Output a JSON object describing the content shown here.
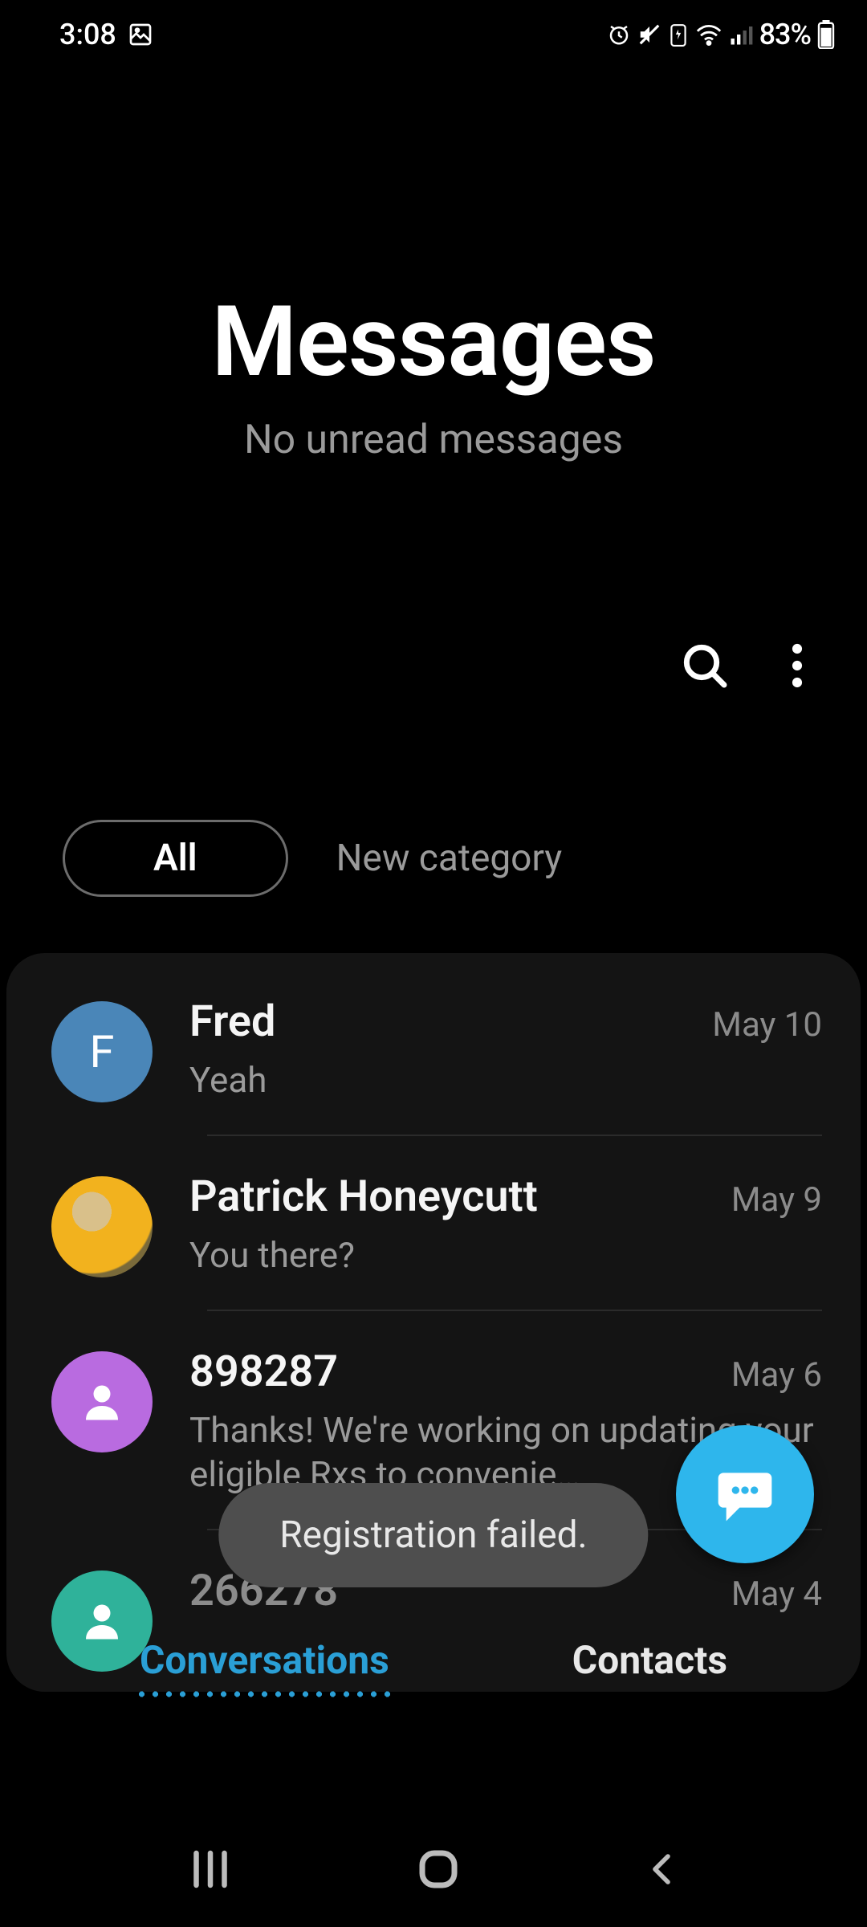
{
  "status": {
    "time": "3:08",
    "battery_text": "83%"
  },
  "header": {
    "title": "Messages",
    "subtitle": "No unread messages"
  },
  "chips": {
    "all": "All",
    "new_category": "New category"
  },
  "conversations": [
    {
      "name": "Fred",
      "preview": "Yeah",
      "date": "May 10",
      "avatar_type": "letter",
      "avatar_letter": "F",
      "avatar_color": "#4a86b8"
    },
    {
      "name": "Patrick Honeycutt",
      "preview": "You there?",
      "date": "May 9",
      "avatar_type": "photo",
      "avatar_letter": "",
      "avatar_color": "#f2b21e"
    },
    {
      "name": "898287",
      "preview": "Thanks! We're working on updating your eligible Rxs to convenie…",
      "date": "May 6",
      "avatar_type": "icon",
      "avatar_letter": "",
      "avatar_color": "#b96be0"
    },
    {
      "name": "266278",
      "preview": "",
      "date": "May 4",
      "avatar_type": "icon",
      "avatar_letter": "",
      "avatar_color": "#2fb29a"
    }
  ],
  "toast": {
    "text": "Registration failed."
  },
  "tabs": {
    "conversations": "Conversations",
    "contacts": "Contacts"
  }
}
